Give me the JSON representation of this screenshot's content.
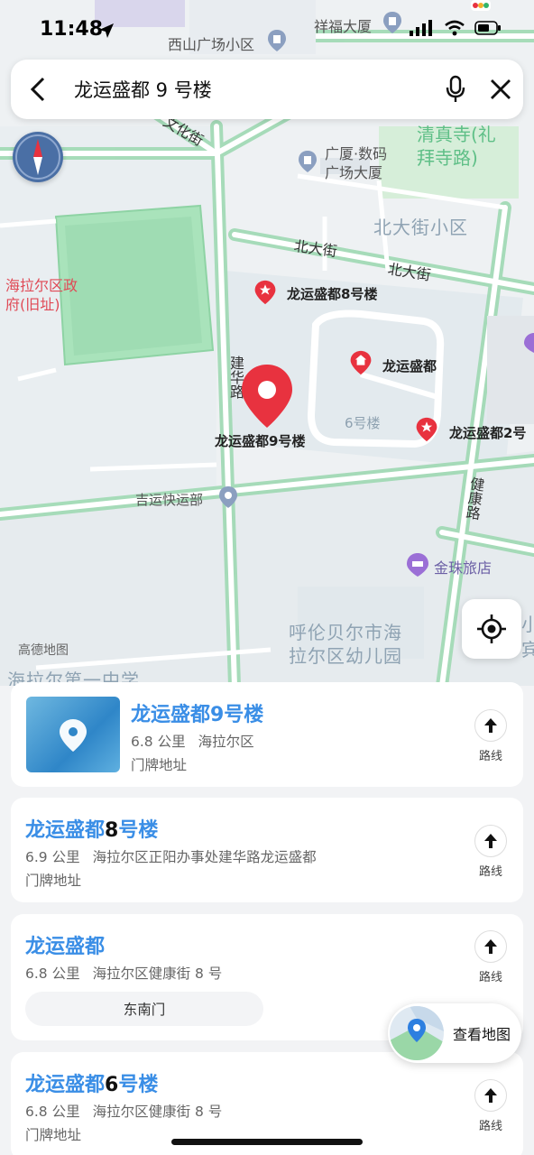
{
  "status": {
    "time": "11:48"
  },
  "search": {
    "query": "龙运盛都 9 号楼"
  },
  "map": {
    "labels": {
      "xiangfu": "祥福大厦",
      "xishan": "西山广场小区",
      "wenhua": "文化街",
      "guangxia": "广厦·数码\n广场大厦",
      "qingzhen": "清真寺(礼\n拜寺路)",
      "beidajie_xq": "北大街小区",
      "beidajie1": "北大街",
      "beidajie2": "北大街",
      "hailaer_gov": "海拉尔区政\n府(旧址)",
      "p8": "龙运盛都8号楼",
      "lysd": "龙运盛都",
      "jianhua": "建华路",
      "p9": "龙运盛都9号楼",
      "b6": "6号楼",
      "p2": "龙运盛都2号",
      "jiankang": "健康路",
      "jiyun": "吉运快运部",
      "jinzhu": "金珠旅店",
      "amap": "高德地图",
      "kinder": "呼伦贝尔市海\n拉尔区幼儿园",
      "school": "海拉尔第一中学",
      "edge1": "小",
      "edge2": "宾旅"
    }
  },
  "results": [
    {
      "title_blue": "龙运盛都9号楼",
      "title_dark": "",
      "title_blue2": "",
      "distance": "6.8 公里",
      "address": "海拉尔区",
      "type": "门牌地址",
      "route": "路线"
    },
    {
      "title_blue": "龙运盛都",
      "title_dark": "8",
      "title_blue2": "号楼",
      "distance": "6.9 公里",
      "address": "海拉尔区正阳办事处建华路龙运盛都",
      "type": "门牌地址",
      "route": "路线"
    },
    {
      "title_blue": "龙运盛都",
      "title_dark": "",
      "title_blue2": "",
      "distance": "6.8 公里",
      "address": "海拉尔区健康街 8 号",
      "chip": "东南门",
      "route": "路线"
    },
    {
      "title_blue": "龙运盛都",
      "title_dark": "6",
      "title_blue2": "号楼",
      "distance": "6.8 公里",
      "address": "海拉尔区健康街 8 号",
      "type": "门牌地址",
      "route": "路线"
    }
  ],
  "view_map": {
    "label": "查看地图"
  },
  "colors": {
    "accent": "#3a8ee6",
    "pin": "#e8323f",
    "road": "#9fd9b3",
    "park": "#a6e1b8"
  }
}
